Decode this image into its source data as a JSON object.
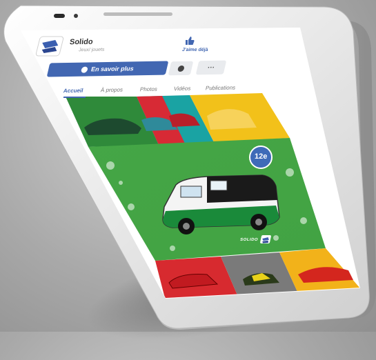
{
  "page": {
    "title": "Solido",
    "subtitle": "Jeux/ jouets",
    "like_label": "J'aime déjà",
    "learn_more_label": "En savoir plus",
    "more_label": "···",
    "tabs": [
      "Accueil",
      "À propos",
      "Photos",
      "Vidéos",
      "Publications"
    ],
    "badge": "12e",
    "brand_mark": "SOLIDO"
  },
  "colors": {
    "facebook_blue": "#4267b2",
    "phone_silver": "#e9e9e9",
    "tile_green": "#3aa23a",
    "tile_yellow": "#f2c11a",
    "tile_red": "#d7262b",
    "tile_teal": "#2ab0b0"
  },
  "icons": [
    "solido-logo-icon",
    "thumbs-up-icon",
    "messenger-icon",
    "camera-icon",
    "speaker-icon"
  ]
}
